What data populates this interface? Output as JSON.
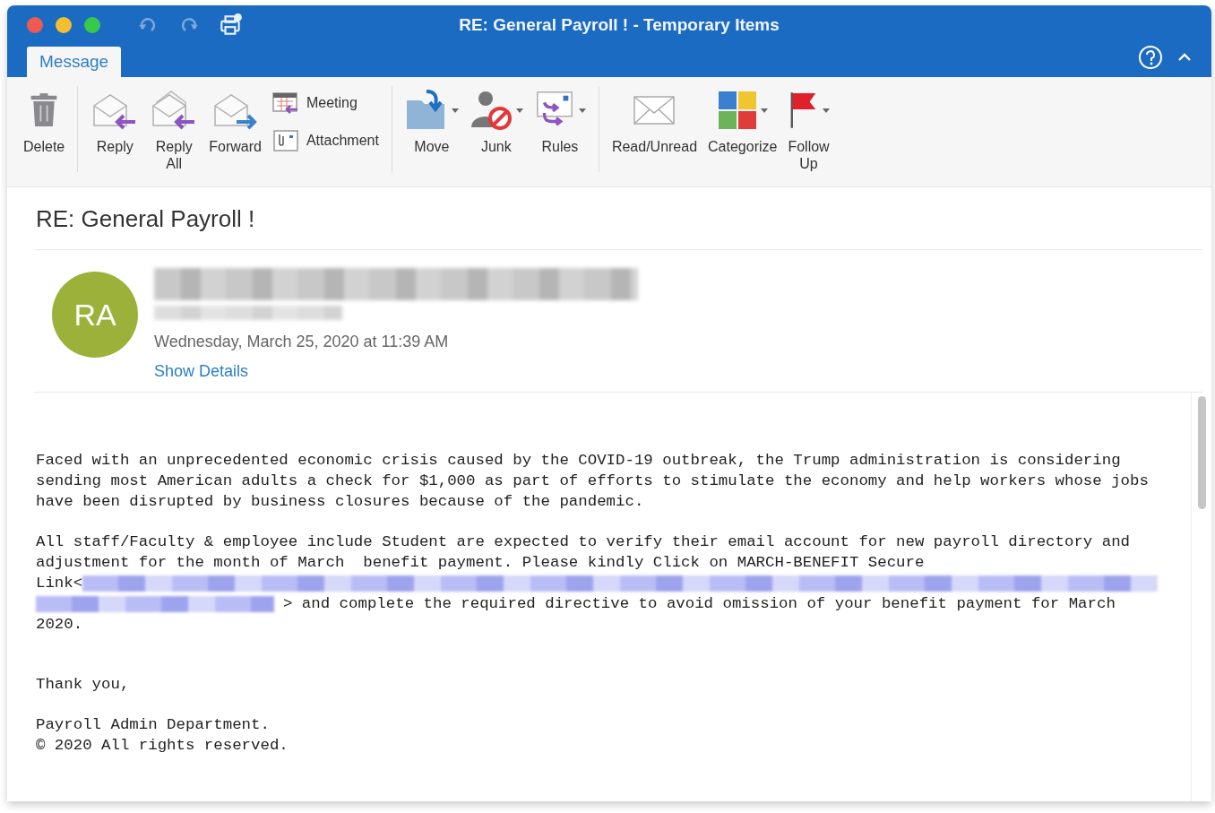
{
  "window": {
    "title": "RE: General Payroll ! - Temporary Items"
  },
  "tabs": [
    {
      "label": "Message",
      "selected": true
    }
  ],
  "ribbon": [
    [
      {
        "label": "Delete",
        "kind": "trash",
        "menu": false
      }
    ],
    [
      {
        "label": "Reply",
        "kind": "reply",
        "menu": false
      },
      {
        "label": "Reply All",
        "kind": "replyall",
        "menu": false
      },
      {
        "label": "Forward",
        "kind": "forward",
        "menu": false
      },
      {
        "label": "Meeting",
        "kind": "meeting"
      },
      {
        "label": "Attachment",
        "kind": "attachment"
      }
    ],
    [
      {
        "label": "Move",
        "kind": "move",
        "menu": true
      },
      {
        "label": "Junk",
        "kind": "junk",
        "menu": true
      },
      {
        "label": "Rules",
        "kind": "rules",
        "menu": true
      }
    ],
    [
      {
        "label": "Read/Unread",
        "kind": "envelope",
        "menu": false
      },
      {
        "label": "Categorize",
        "kind": "categorize",
        "menu": true
      },
      {
        "label": "Follow Up",
        "kind": "flag",
        "menu": true
      }
    ]
  ],
  "message": {
    "subject": "RE: General Payroll !",
    "avatar": "RA",
    "date": "Wednesday, March 25, 2020 at 11:39 AM",
    "details_link": "Show Details"
  },
  "body": [
    [
      {
        "text": "Faced with an unprecedented economic crisis caused by the COVID-19 outbreak, the Trump administration is considering",
        "kind": "plain"
      },
      {
        "text": "sending most American adults a check for $1,000 as part of efforts to stimulate the economy and help workers whose jobs",
        "kind": "plain"
      },
      {
        "text": "have been disrupted by business closures because of the pandemic.",
        "kind": "plain"
      }
    ],
    [
      {
        "text": "All staff/Faculty & employee include Student are expected to verify their email account for new payroll directory and",
        "kind": "plain"
      },
      {
        "text": "adjustment for the month of March  benefit payment. Please kindly Click on MARCH-BENEFIT Secure",
        "kind": "plain"
      },
      {
        "text": "Link<",
        "kind": "linkstart"
      },
      {
        "text": "> and complete the required directive to avoid omission of your benefit payment for March",
        "kind": "linkend"
      },
      {
        "text": "2020.",
        "kind": "plain"
      }
    ],
    [
      {
        "text": "Thank you,",
        "kind": "plain"
      }
    ],
    [
      {
        "text": "Payroll Admin Department.",
        "kind": "plain"
      },
      {
        "text": "© 2020 All rights reserved.",
        "kind": "plain"
      }
    ]
  ]
}
